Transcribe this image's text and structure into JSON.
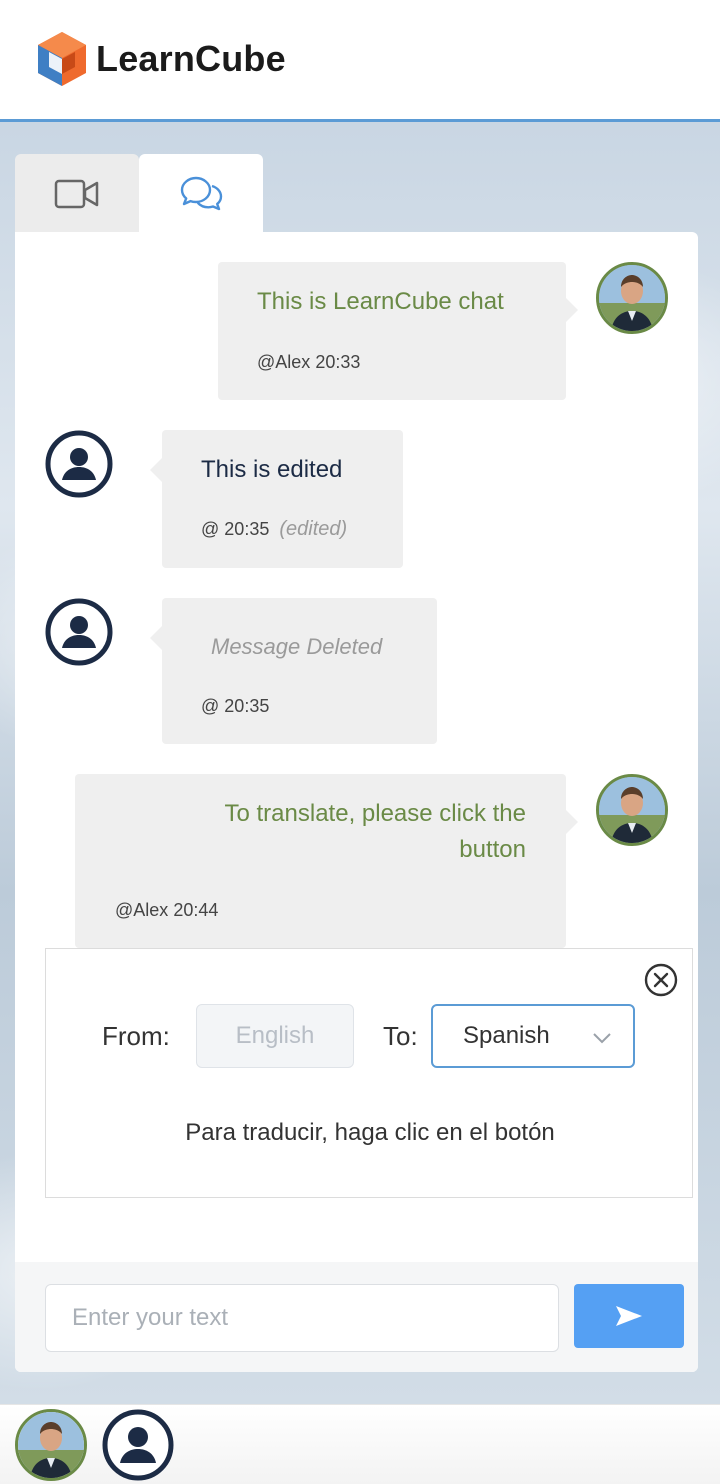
{
  "app": {
    "brand": "LearnCube",
    "accent_color": "#5b9bd5",
    "own_message_color": "#6a8a46",
    "send_button_color": "#55a0f3"
  },
  "tabs": [
    {
      "name": "video",
      "icon": "video-camera-icon",
      "active": false
    },
    {
      "name": "chat",
      "icon": "chat-bubbles-icon",
      "active": true
    }
  ],
  "messages": [
    {
      "text": "This is LearnCube chat",
      "author": "@Alex",
      "time": "20:33",
      "own": true
    },
    {
      "text": "This is edited",
      "author": "@",
      "time": "20:35",
      "own": false,
      "edited_label": "(edited)"
    },
    {
      "text": "Message Deleted",
      "author": "@",
      "time": "20:35",
      "own": false,
      "deleted": true
    },
    {
      "text_line1": "To translate, please click the",
      "text_line2": "button",
      "author": "@Alex",
      "time": "20:44",
      "own": true
    }
  ],
  "translate": {
    "from_label": "From:",
    "from_value": "English",
    "to_label": "To:",
    "to_value": "Spanish",
    "result": "Para traducir, haga clic en el botón"
  },
  "composer": {
    "placeholder": "Enter your text",
    "value": ""
  },
  "footer": {
    "participants": [
      "teacher-avatar",
      "student-avatar"
    ]
  }
}
